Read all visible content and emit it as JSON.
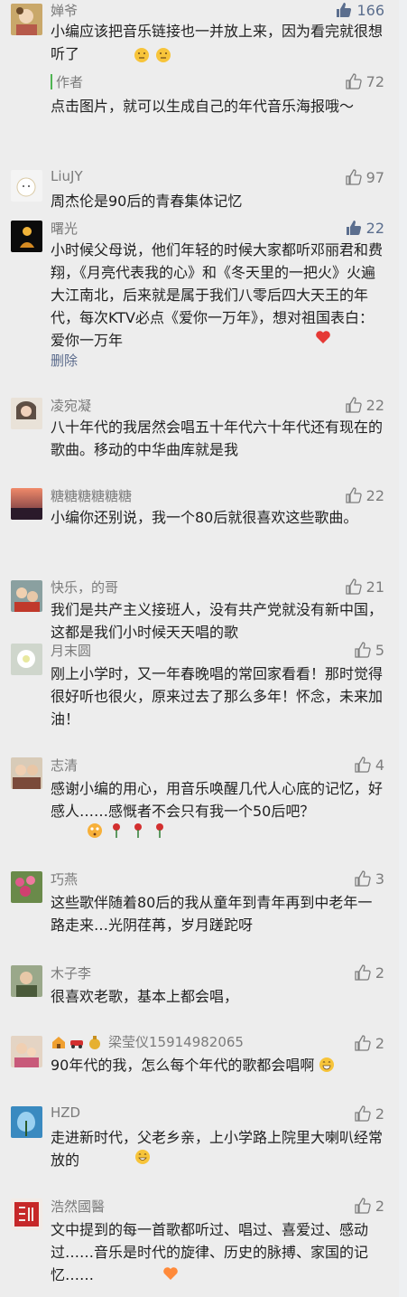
{
  "comments": [
    {
      "name": "婵爷",
      "likes": "166",
      "text": "小编应该把音乐链接也一并放上来，因为看完就很想听了",
      "reply": {
        "author": "作者",
        "likes": "72",
        "text": "点击图片，就可以生成自己的年代音乐海报哦～"
      }
    },
    {
      "name": "LiuJY",
      "likes": "97",
      "text": "周杰伦是90后的青春集体记忆"
    },
    {
      "name": "曙光",
      "likes": "22",
      "text": "小时候父母说，他们年轻的时候大家都听邓丽君和费翔，《月亮代表我的心》和《冬天里的一把火》火遍大江南北，后来就是属于我们八零后四大天王的年代，每次KTV必点《爱你一万年》，想对祖国表白：爱你一万年",
      "delete": "删除"
    },
    {
      "name": "凌宛凝",
      "likes": "22",
      "text": "八十年代的我居然会唱五十年代六十年代还有现在的歌曲。移动的中华曲库就是我"
    },
    {
      "name": "糖糖糖糖糖糖",
      "likes": "22",
      "text": "小编你还别说，我一个80后就很喜欢这些歌曲。"
    },
    {
      "name": "快乐，的哥",
      "likes": "21",
      "text": "我们是共产主义接班人，没有共产党就没有新中国，这都是我们小时候天天唱的歌"
    },
    {
      "name": "月末圆",
      "likes": "5",
      "text": "刚上小学时，又一年春晚唱的常回家看看！那时觉得很好听也很火，原来过去了那么多年！怀念，未来加油！"
    },
    {
      "name": "志清",
      "likes": "4",
      "text": "感谢小编的用心，用音乐唤醒几代人心底的记忆，好感人……感慨者不会只有我一个50后吧？"
    },
    {
      "name": "巧燕",
      "likes": "3",
      "text": "这些歌伴随着80后的我从童年到青年再到中老年一路走来…光阴荏苒，岁月蹉跎呀"
    },
    {
      "name": "木子李",
      "likes": "2",
      "text": "很喜欢老歌，基本上都会唱，"
    },
    {
      "name": "梁莹仪15914982065",
      "likes": "2",
      "text": "90年代的我，怎么每个年代的歌都会唱啊"
    },
    {
      "name": "HZD",
      "likes": "2",
      "text": "走进新时代，父老乡亲，上小学路上院里大喇叭经常放的"
    },
    {
      "name": "浩然國醫",
      "likes": "2",
      "text": "文中提到的每一首歌都听过、唱过、喜爱过、感动过……音乐是时代的旋律、历史的脉搏、家国的记忆……"
    }
  ],
  "colors": {
    "background": "#ededed",
    "name": "#7b7b7b",
    "text": "#1f1f1f",
    "like_active": "#5b6e8e",
    "author_bar": "#4fb452",
    "delete_link": "#5b6b8c"
  }
}
